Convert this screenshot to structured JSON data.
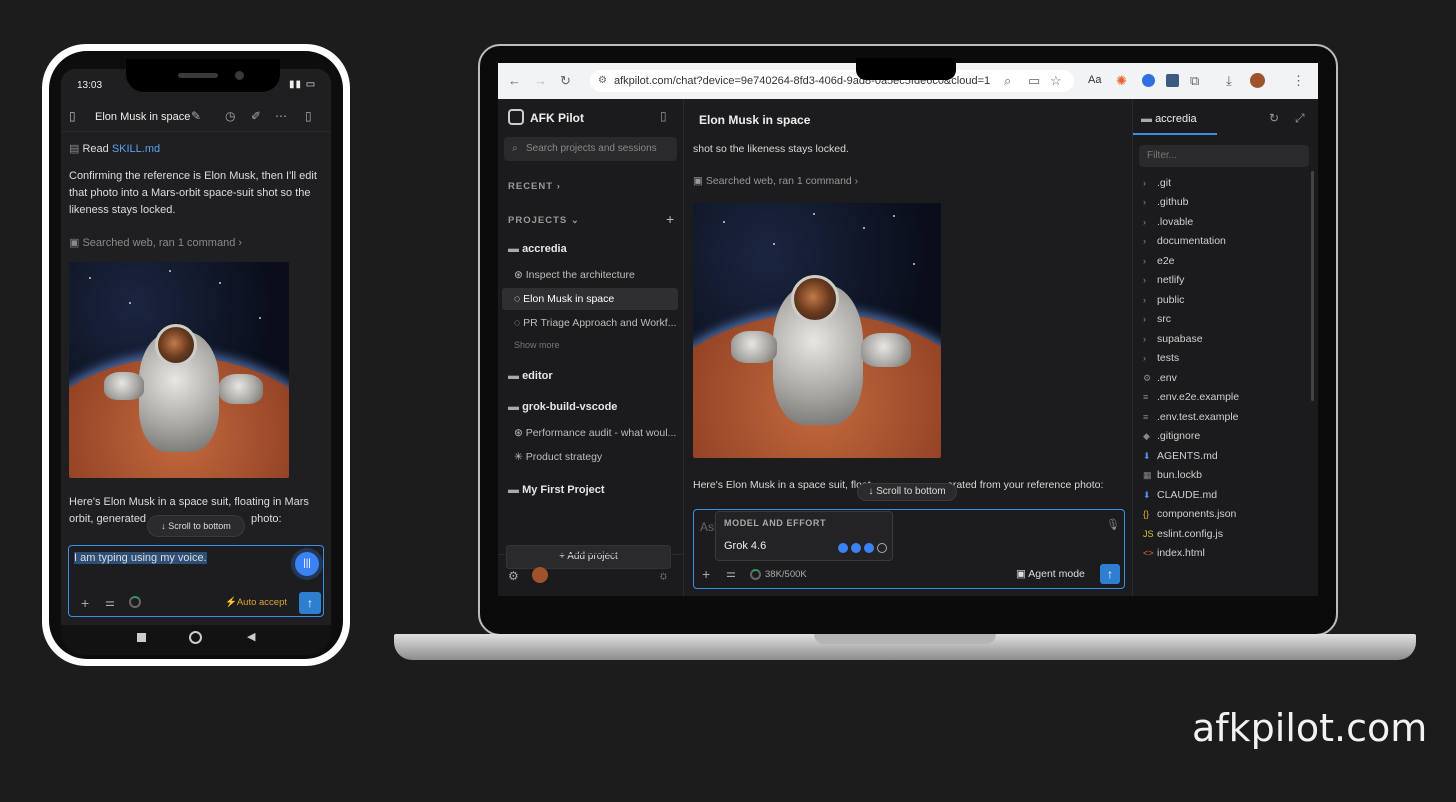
{
  "brand": "afkpilot.com",
  "phone": {
    "status_time": "13:03",
    "title": "Elon Musk in space",
    "read_prefix": "Read",
    "read_file": "SKILL.md",
    "message_1": "Confirming the reference is Elon Musk, then I'll edit that photo into a Mars-orbit space-suit shot so the likeness stays locked.",
    "tool_summary": "Searched web, ran 1 command",
    "message_2_line1": "Here's Elon Musk in a space suit, floating in Mars",
    "message_2_line2_a": "orbit, generated",
    "message_2_line2_b": "photo:",
    "scroll_to_bottom": "Scroll to bottom",
    "input_value": "I am typing using my voice.",
    "auto_accept": "Auto accept"
  },
  "browser": {
    "url": "afkpilot.com/chat?device=9e740264-8fd3-406d-9ad8-0a5ec5fde6c0&cloud=1"
  },
  "sidebar": {
    "app_name": "AFK Pilot",
    "search_placeholder": "Search projects and sessions",
    "recent_label": "RECENT",
    "projects_label": "PROJECTS",
    "projects": [
      {
        "name": "accredia",
        "sessions": [
          "Inspect the architecture",
          "Elon Musk in space",
          "PR Triage Approach and Workf..."
        ],
        "show_more": "Show more"
      },
      {
        "name": "editor",
        "sessions": []
      },
      {
        "name": "grok-build-vscode",
        "sessions": [
          "Performance audit - what woul...",
          "Product strategy"
        ]
      },
      {
        "name": "My First Project",
        "sessions": []
      }
    ],
    "add_project": "+ Add project"
  },
  "main": {
    "title": "Elon Musk in space",
    "top_text": "shot so the likeness stays locked.",
    "tool_summary": "Searched web, ran 1 command",
    "message_a": "Here's Elon Musk in a space suit, float",
    "message_b": "erated from your reference photo:",
    "scroll_to_bottom": "Scroll to bottom",
    "input_placeholder": "Ask",
    "popup_header": "MODEL AND EFFORT",
    "model_name": "Grok 4.6",
    "effort_level": 3,
    "effort_max": 4,
    "tokens": "38K/500K",
    "agent_mode": "Agent mode"
  },
  "files": {
    "root": "accredia",
    "filter_placeholder": "Filter...",
    "folders": [
      ".git",
      ".github",
      ".lovable",
      "documentation",
      "e2e",
      "netlify",
      "public",
      "src",
      "supabase",
      "tests"
    ],
    "items": [
      ".env",
      ".env.e2e.example",
      ".env.test.example",
      ".gitignore",
      "AGENTS.md",
      "bun.lockb",
      "CLAUDE.md",
      "components.json",
      "eslint.config.js",
      "index.html"
    ]
  }
}
